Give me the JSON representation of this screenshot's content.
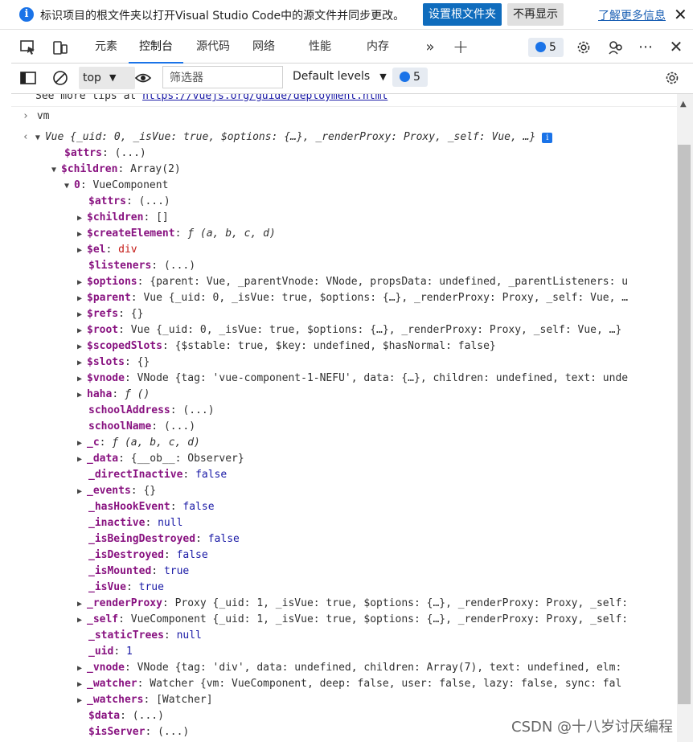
{
  "infobar": {
    "message": "标识项目的根文件夹以打开Visual Studio Code中的源文件并同步更改。",
    "primary_button": "设置根文件夹",
    "secondary_button": "不再显示",
    "learn_more": "了解更多信息"
  },
  "tabs": [
    {
      "label": "元素"
    },
    {
      "label": "控制台"
    },
    {
      "label": "源代码"
    },
    {
      "label": "网络"
    },
    {
      "label": "性能"
    },
    {
      "label": "内存"
    }
  ],
  "issues_count": "5",
  "toolbar": {
    "context": "top",
    "filter_placeholder": "筛选器",
    "levels": "Default levels",
    "issues_count": "5"
  },
  "console": {
    "tip_prefix": "See more tips at ",
    "tip_link": "https://vuejs.org/guide/deployment.html",
    "input": "vm",
    "vue_summary": "Vue {_uid: 0, _isVue: true, $options: {…}, _renderProxy: Proxy, _self: Vue, …}",
    "rows": [
      {
        "key": "$attrs",
        "val": "(...)"
      },
      {
        "key": "$children",
        "val": "Array(2)"
      },
      {
        "key": "0",
        "val": "VueComponent"
      },
      {
        "key": "$attrs",
        "val": "(...)"
      },
      {
        "key": "$children",
        "val": "[]"
      },
      {
        "key": "$createElement",
        "val": "ƒ (a, b, c, d)"
      },
      {
        "key": "$el",
        "val": "div"
      },
      {
        "key": "$listeners",
        "val": "(...)"
      },
      {
        "key": "$options",
        "val": "{parent: Vue, _parentVnode: VNode, propsData: undefined, _parentListeners: u"
      },
      {
        "key": "$parent",
        "val": "Vue {_uid: 0, _isVue: true, $options: {…}, _renderProxy: Proxy, _self: Vue, …"
      },
      {
        "key": "$refs",
        "val": "{}"
      },
      {
        "key": "$root",
        "val": "Vue {_uid: 0, _isVue: true, $options: {…}, _renderProxy: Proxy, _self: Vue, …}"
      },
      {
        "key": "$scopedSlots",
        "val": "{$stable: true, $key: undefined, $hasNormal: false}"
      },
      {
        "key": "$slots",
        "val": "{}"
      },
      {
        "key": "$vnode",
        "val": "VNode {tag: 'vue-component-1-NEFU', data: {…}, children: undefined, text: unde"
      },
      {
        "key": "haha",
        "val": "ƒ ()"
      },
      {
        "key": "schoolAddress",
        "val": "(...)"
      },
      {
        "key": "schoolName",
        "val": "(...)"
      },
      {
        "key": "_c",
        "val": "ƒ (a, b, c, d)"
      },
      {
        "key": "_data",
        "val": "{__ob__: Observer}"
      },
      {
        "key": "_directInactive",
        "val": "false"
      },
      {
        "key": "_events",
        "val": "{}"
      },
      {
        "key": "_hasHookEvent",
        "val": "false"
      },
      {
        "key": "_inactive",
        "val": "null"
      },
      {
        "key": "_isBeingDestroyed",
        "val": "false"
      },
      {
        "key": "_isDestroyed",
        "val": "false"
      },
      {
        "key": "_isMounted",
        "val": "true"
      },
      {
        "key": "_isVue",
        "val": "true"
      },
      {
        "key": "_renderProxy",
        "val": "Proxy {_uid: 1, _isVue: true, $options: {…}, _renderProxy: Proxy, _self:"
      },
      {
        "key": "_self",
        "val": "VueComponent {_uid: 1, _isVue: true, $options: {…}, _renderProxy: Proxy, _self:"
      },
      {
        "key": "_staticTrees",
        "val": "null"
      },
      {
        "key": "_uid",
        "val": "1"
      },
      {
        "key": "_vnode",
        "val": "VNode {tag: 'div', data: undefined, children: Array(7), text: undefined, elm:"
      },
      {
        "key": "_watcher",
        "val": "Watcher {vm: VueComponent, deep: false, user: false, lazy: false, sync: fal"
      },
      {
        "key": "_watchers",
        "val": "[Watcher]"
      },
      {
        "key": "$data",
        "val": "(...)"
      },
      {
        "key": "$isServer",
        "val": "(...)"
      }
    ]
  },
  "watermark": "CSDN @十八岁讨厌编程"
}
